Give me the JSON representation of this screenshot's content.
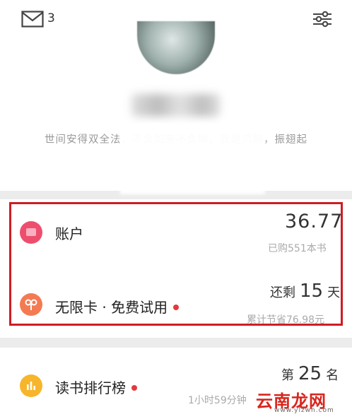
{
  "header": {
    "mail_count": "3",
    "motto": "世间安得双全法，不负如来不负卿。我是鸿鹄，振翅起"
  },
  "account": {
    "label": "账户",
    "balance": "36.77",
    "purchased": "已购551本书"
  },
  "unlimited": {
    "label": "无限卡 · 免费试用",
    "remain_prefix": "还剩",
    "remain_days": "15",
    "remain_unit": "天",
    "saved": "累计节省76.98元"
  },
  "ranking": {
    "label": "读书排行榜",
    "rank_prefix": "第",
    "rank_value": "25",
    "rank_unit": "名",
    "duration": "1小时59分钟"
  },
  "watermark": {
    "brand": "云南龙网",
    "url": "www.ylzwn.com"
  },
  "colors": {
    "highlight": "#cf1c24",
    "account_icon": "#ee4e6e",
    "unlimited_icon": "#f47a52",
    "ranking_icon": "#f7b52b",
    "red_dot": "#e4393c"
  }
}
